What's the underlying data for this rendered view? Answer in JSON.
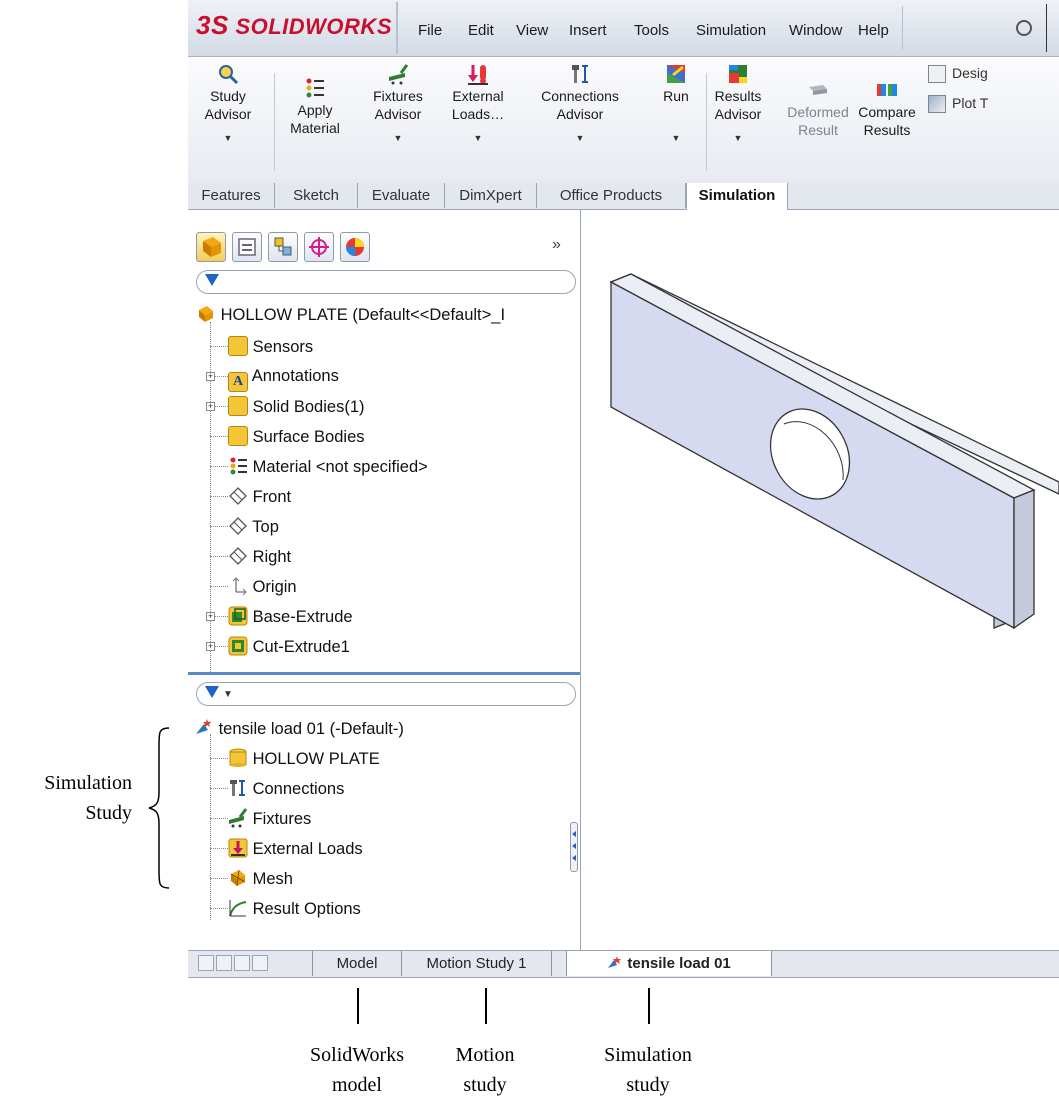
{
  "menubar": {
    "logo_ds": "3S",
    "logo_text": "SOLIDWORKS",
    "items": [
      "File",
      "Edit",
      "View",
      "Insert",
      "Tools",
      "Simulation",
      "Window",
      "Help"
    ]
  },
  "ribbon": {
    "study_advisor": [
      "Study",
      "Advisor"
    ],
    "apply_material": [
      "Apply",
      "Material"
    ],
    "fixtures_advisor": [
      "Fixtures",
      "Advisor"
    ],
    "external_loads": [
      "External",
      "Loads…"
    ],
    "connections_advisor": [
      "Connections",
      "Advisor"
    ],
    "run": "Run",
    "results_advisor": [
      "Results",
      "Advisor"
    ],
    "deformed_result": [
      "Deformed",
      "Result"
    ],
    "compare_results": [
      "Compare",
      "Results"
    ],
    "design": "Desig",
    "plot": "Plot T"
  },
  "command_tabs": [
    "Features",
    "Sketch",
    "Evaluate",
    "DimXpert",
    "Office Products",
    "Simulation"
  ],
  "feature_tree": {
    "more": "»",
    "root": "HOLLOW PLATE  (Default<<Default>_I",
    "items": [
      "Sensors",
      "Annotations",
      "Solid Bodies(1)",
      "Surface Bodies",
      "Material <not specified>",
      "Front",
      "Top",
      "Right",
      "Origin",
      "Base-Extrude",
      "Cut-Extrude1"
    ]
  },
  "study_tree": {
    "root": "tensile load 01 (-Default-)",
    "items": [
      "HOLLOW PLATE",
      "Connections",
      "Fixtures",
      "External Loads",
      "Mesh",
      "Result Options"
    ]
  },
  "bottom_tabs": [
    "Model",
    "Motion Study 1",
    "tensile load 01"
  ],
  "annotations": {
    "simulation_study_side": [
      "Simulation",
      "Study"
    ],
    "solidworks_model": [
      "SolidWorks",
      "model"
    ],
    "motion_study": [
      "Motion",
      "study"
    ],
    "simulation_study": [
      "Simulation",
      "study"
    ]
  },
  "colors": {
    "brand": "#c8102e",
    "plate_face": "#d6daf0",
    "selection_blue": "#5a87c5"
  }
}
